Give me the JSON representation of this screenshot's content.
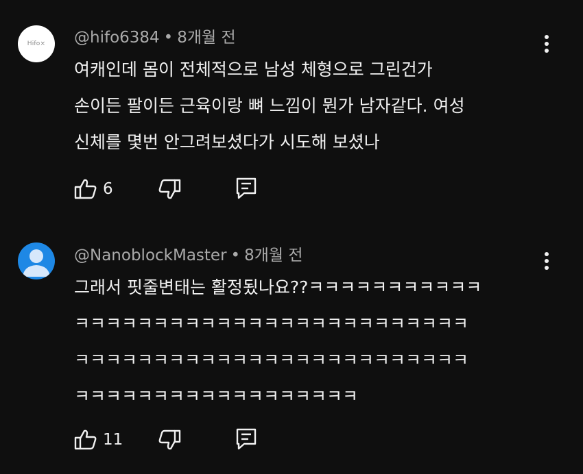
{
  "comments": [
    {
      "avatar": {
        "type": "logo",
        "text": "Hifo×"
      },
      "author": "@hifo6384",
      "separator": "•",
      "time": "8개월 전",
      "lines": [
        "여캐인데 몸이 전체적으로 남성 체형으로 그린건가",
        "손이든 팔이든 근육이랑 뼈 느낌이 뭔가 남자같다. 여성",
        "신체를 몇번 안그려보셨다가 시도해 보셨나"
      ],
      "likes": "6",
      "icons": [
        "more-vert-icon",
        "thumb-up-icon",
        "thumb-down-icon",
        "reply-icon"
      ]
    },
    {
      "avatar": {
        "type": "default"
      },
      "author": "@NanoblockMaster",
      "separator": "•",
      "time": "8개월 전",
      "lines": [
        "그래서 핏줄변태는 활정됬나요??ㅋㅋㅋㅋㅋㅋㅋㅋㅋㅋㅋ",
        "ㅋㅋㅋㅋㅋㅋㅋㅋㅋㅋㅋㅋㅋㅋㅋㅋㅋㅋㅋㅋㅋㅋㅋㅋㅋ",
        "ㅋㅋㅋㅋㅋㅋㅋㅋㅋㅋㅋㅋㅋㅋㅋㅋㅋㅋㅋㅋㅋㅋㅋㅋㅋ",
        "ㅋㅋㅋㅋㅋㅋㅋㅋㅋㅋㅋㅋㅋㅋㅋㅋㅋㅋ"
      ],
      "likes": "11",
      "icons": [
        "more-vert-icon",
        "thumb-up-icon",
        "thumb-down-icon",
        "reply-icon"
      ]
    }
  ],
  "colors": {
    "background": "#0f0f0f",
    "text": "#f1f1f1",
    "meta": "#aaaaaa",
    "default_avatar": "#1e88e5"
  }
}
